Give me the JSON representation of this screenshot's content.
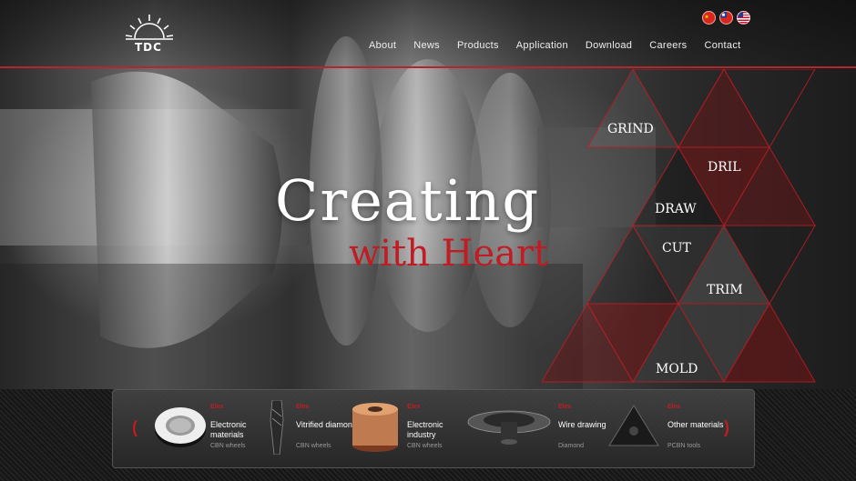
{
  "brand": {
    "logo_text": "TDC"
  },
  "header": {
    "flags": [
      "china-flag-icon",
      "taiwan-flag-icon",
      "usa-flag-icon"
    ],
    "nav": [
      "About",
      "News",
      "Products",
      "Application",
      "Download",
      "Careers",
      "Contact"
    ]
  },
  "hero": {
    "title": "Creating",
    "subtitle": "with Heart"
  },
  "processes": [
    "GRIND",
    "DRIL",
    "DRAW",
    "CUT",
    "TRIM",
    "MOLD"
  ],
  "products": [
    {
      "tag": "Elex",
      "name": "Electronic materials",
      "sub": "CBN wheels",
      "icon": "cbn-wheel-icon"
    },
    {
      "tag": "Elex",
      "name": "Vitrified diamond",
      "sub": "CBN wheels",
      "icon": "drill-bit-icon"
    },
    {
      "tag": "Elex",
      "name": "Electronic industry",
      "sub": "CBN wheels",
      "icon": "wire-spool-icon"
    },
    {
      "tag": "Elex",
      "name": "Wire drawing",
      "sub": "Diamond",
      "icon": "drawing-die-icon"
    },
    {
      "tag": "Elex",
      "name": "Other materials",
      "sub": "PCBN tools",
      "icon": "insert-tool-icon"
    }
  ],
  "carousel": {
    "prev": "(",
    "next": ")"
  },
  "colors": {
    "accent": "#c01c24",
    "dark_red": "#6e1416",
    "line": "#b3262b"
  }
}
